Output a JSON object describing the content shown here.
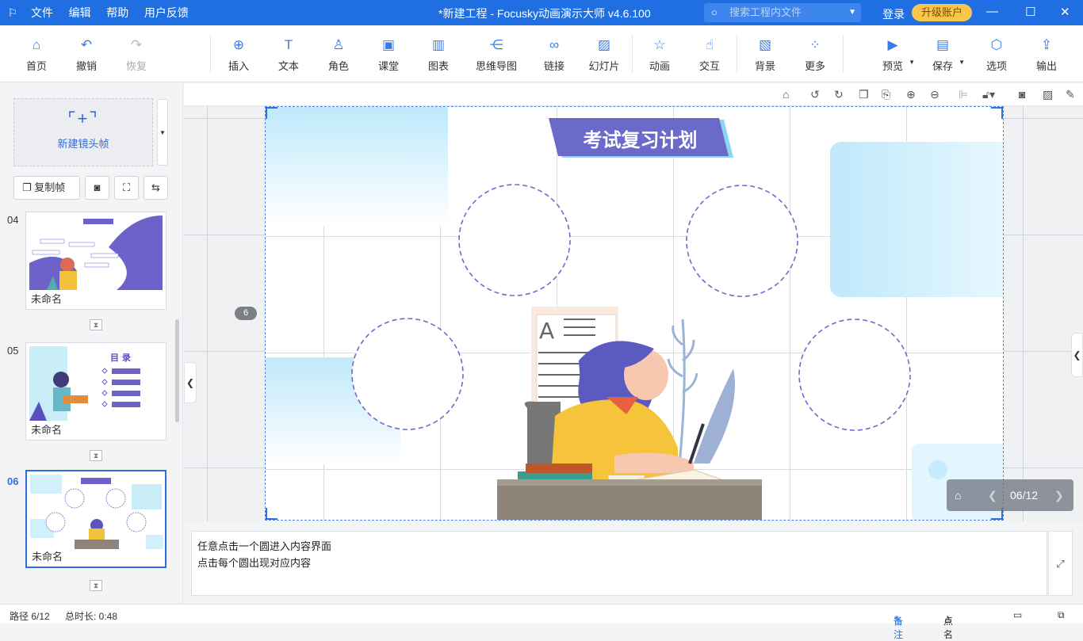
{
  "titlebar": {
    "menu": [
      "文件",
      "编辑",
      "帮助",
      "用户反馈"
    ],
    "title": "*新建工程 - Focusky动画演示大师  v4.6.100",
    "search_placeholder": "搜索工程内文件",
    "login": "登录",
    "upgrade": "升级账户"
  },
  "toolbar": {
    "items": [
      {
        "label": "首页",
        "icon": "home-icon"
      },
      {
        "label": "撤销",
        "icon": "undo-icon"
      },
      {
        "label": "恢复",
        "icon": "redo-icon"
      },
      {
        "label": "插入",
        "icon": "plus-circle-icon"
      },
      {
        "label": "文本",
        "icon": "text-icon"
      },
      {
        "label": "角色",
        "icon": "character-icon"
      },
      {
        "label": "课堂",
        "icon": "classroom-icon"
      },
      {
        "label": "图表",
        "icon": "chart-icon"
      },
      {
        "label": "思维导图",
        "icon": "mindmap-icon"
      },
      {
        "label": "链接",
        "icon": "link-icon"
      },
      {
        "label": "幻灯片",
        "icon": "slideshow-icon"
      },
      {
        "label": "动画",
        "icon": "star-icon"
      },
      {
        "label": "交互",
        "icon": "hand-icon"
      },
      {
        "label": "背景",
        "icon": "background-icon"
      },
      {
        "label": "更多",
        "icon": "more-icon"
      },
      {
        "label": "预览",
        "icon": "play-icon"
      },
      {
        "label": "保存",
        "icon": "save-icon"
      },
      {
        "label": "选项",
        "icon": "settings-icon"
      },
      {
        "label": "输出",
        "icon": "export-icon"
      }
    ]
  },
  "left": {
    "new_frame": "新建镜头帧",
    "copy_frame": "复制帧",
    "slides": [
      {
        "num": "04",
        "name": "未命名"
      },
      {
        "num": "05",
        "name": "未命名"
      },
      {
        "num": "06",
        "name": "未命名"
      }
    ]
  },
  "canvas": {
    "slide_title": "考试复习计划",
    "frame_badge": "6",
    "pager": "06/12"
  },
  "notes": {
    "line1": "任意点击一个圆进入内容界面",
    "line2": "点击每个圆出现对应内容"
  },
  "status": {
    "path": "路径 6/12",
    "duration": "总时长: 0:48",
    "notes_btn": "备注",
    "rollcall_btn": "点名"
  },
  "colors": {
    "accent": "#1f6fe3",
    "slide_title_bg": "#6b6acb",
    "circle_dash": "#6b6acb"
  }
}
